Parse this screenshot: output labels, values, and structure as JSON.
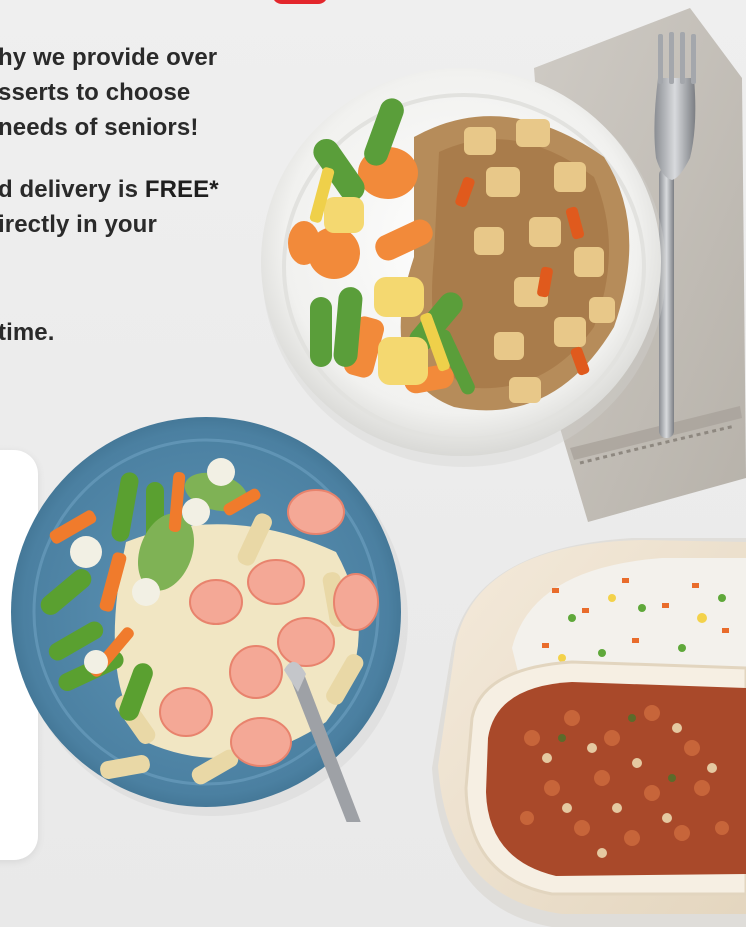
{
  "marketing_copy": {
    "line1": "hy we provide over",
    "line2": "sserts to choose",
    "line3": "needs of seniors!",
    "line4_prefix": "d delivery is ",
    "line4_emphasis": "FREE*",
    "line5": "irectly in your",
    "line6": "time."
  },
  "images": {
    "chicken_rice_meal": "chicken-and-brown-rice-with-vegetables",
    "shrimp_pasta_meal": "shrimp-rotini-pasta-with-vegetables",
    "chili_rice_meal": "bean-chili-with-vegetable-rice",
    "napkin": "grey-cloth-napkin",
    "fork": "silver-fork"
  },
  "colors": {
    "background": "#ececec",
    "accent_red": "#e3262c",
    "text": "#2a2a2a",
    "blue_plate": "#4f86a8",
    "white_plate": "#f7f7f5",
    "beige_tray": "#efe3cf"
  }
}
